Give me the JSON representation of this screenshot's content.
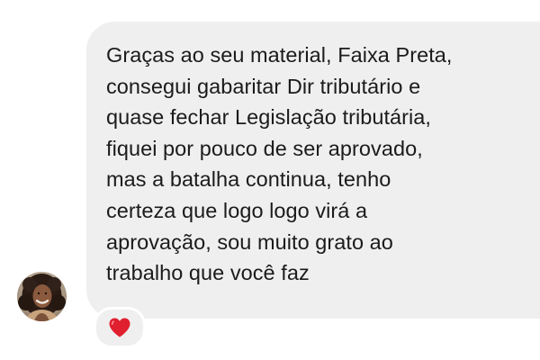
{
  "message": {
    "lines": [
      "Graças ao seu material, Faixa Preta,",
      "consegui gabaritar Dir tributário e",
      "quase fechar Legislação tributária,",
      "fiquei por pouco de ser aprovado,",
      "mas a batalha continua, tenho",
      "certeza que logo logo virá a",
      "aprovação, sou muito grato ao",
      "trabalho que você faz"
    ]
  },
  "reaction": {
    "icon": "red-heart-icon",
    "color": "#e0202e"
  },
  "avatar": {
    "icon": "user-avatar-photo"
  },
  "colors": {
    "bubble_bg": "#efefef",
    "text": "#1b1b1b",
    "page_bg": "#ffffff"
  }
}
